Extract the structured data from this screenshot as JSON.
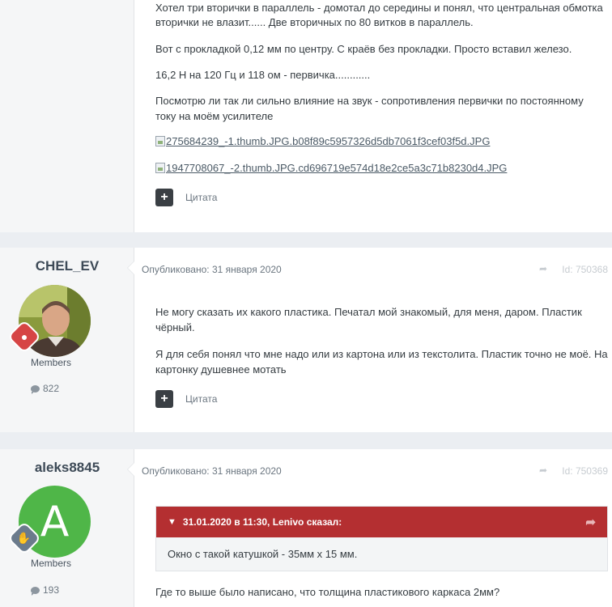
{
  "post1": {
    "lines": [
      "Хотел три вторички в параллель  - домотал до середины и понял, что центральная обмотка",
      "вторички не влазит...... Две вторичных по 80 витков в параллель.",
      "Вот с прокладкой 0,12 мм по центру. С краёв без прокладки. Просто вставил железо.",
      "16,2 Н на 120 Гц и 118 ом - первичка............",
      "Посмотрю ли так ли сильно влияние на звук - сопротивления первички по постоянному",
      "току на моём усилителе"
    ],
    "images": [
      "275684239_-1.thumb.JPG.b08f89c5957326d5db7061f3cef03f5d.JPG",
      "1947708067_-2.thumb.JPG.cd696719e574d18e2ce5a3c71b8230d4.JPG"
    ],
    "plus_label": "+",
    "quote_label": "Цитата"
  },
  "post2": {
    "username": "CHEL_EV",
    "group": "Members",
    "post_count": "822",
    "published": "Опубликовано: 31 января 2020",
    "post_id": "Id: 750368",
    "lines": [
      "Не могу сказать их какого пластика. Печатал мой знакомый, для меня, даром. Пластик",
      "чёрный.",
      "Я для себя понял что мне надо или из картона или из текстолита. Пластик точно не моё. На",
      "картонку душевнее мотать"
    ],
    "plus_label": "+",
    "quote_label": "Цитата",
    "badge_color": "#d64545"
  },
  "post3": {
    "username": "aleks8845",
    "group": "Members",
    "post_count": "193",
    "avatar_letter": "A",
    "avatar_color": "#4fb648",
    "published": "Опубликовано: 31 января 2020",
    "post_id": "Id: 750369",
    "quote": {
      "header": "31.01.2020 в 11:30, Lenivo сказал:",
      "body": "Окно с такой катушкой  - 35мм х 15 мм.",
      "color": "#b42f31"
    },
    "line": "Где то выше было написано, что толщина пластикового каркаса 2мм?",
    "badge_color": "#6b7b8c"
  }
}
